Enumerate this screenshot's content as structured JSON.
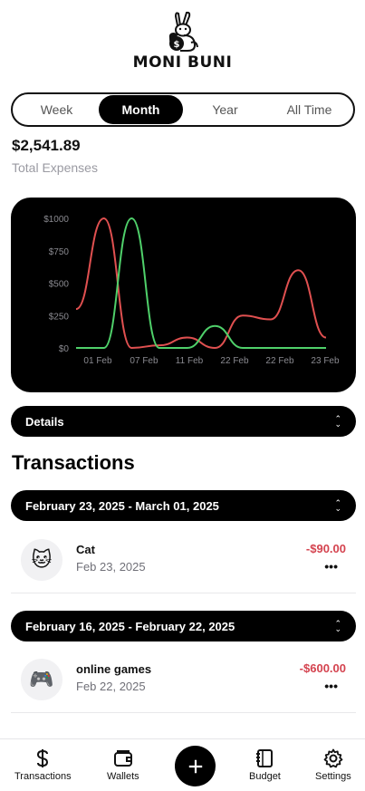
{
  "app": {
    "logo_text": "MONI BUNI"
  },
  "period": {
    "tabs": [
      {
        "label": "Week",
        "active": false
      },
      {
        "label": "Month",
        "active": true
      },
      {
        "label": "Year",
        "active": false
      },
      {
        "label": "All Time",
        "active": false
      }
    ]
  },
  "summary": {
    "total": "$2,541.89",
    "label": "Total Expenses"
  },
  "chart_data": {
    "type": "line",
    "x": [
      "01 Feb",
      "07 Feb",
      "11 Feb",
      "22 Feb",
      "22 Feb",
      "23 Feb"
    ],
    "yticks": [
      "$1000",
      "$750",
      "$500",
      "$250",
      "$0"
    ],
    "ylim": [
      0,
      1000
    ],
    "grid": false,
    "series": [
      {
        "color": "#e05050",
        "points": [
          [
            0,
            300
          ],
          [
            1,
            1000
          ],
          [
            2,
            0
          ],
          [
            3,
            20
          ],
          [
            4,
            80
          ],
          [
            5,
            0
          ],
          [
            6,
            250
          ],
          [
            7,
            220
          ],
          [
            8,
            600
          ],
          [
            9,
            80
          ]
        ]
      },
      {
        "color": "#4fd06a",
        "points": [
          [
            0,
            0
          ],
          [
            1,
            0
          ],
          [
            2,
            1000
          ],
          [
            3,
            0
          ],
          [
            4,
            0
          ],
          [
            5,
            170
          ],
          [
            6,
            0
          ],
          [
            7,
            0
          ],
          [
            8,
            0
          ],
          [
            9,
            0
          ]
        ]
      }
    ]
  },
  "details": {
    "label": "Details"
  },
  "transactions": {
    "title": "Transactions",
    "groups": [
      {
        "range": "February 23, 2025 - March 01, 2025",
        "items": [
          {
            "icon": "cat-icon",
            "emoji": "🐱",
            "name": "Cat",
            "date": "Feb 23, 2025",
            "amount": "-$90.00"
          }
        ]
      },
      {
        "range": "February 16, 2025 - February 22, 2025",
        "items": [
          {
            "icon": "gamepad-icon",
            "emoji": "🎮",
            "name": "online games",
            "date": "Feb 22, 2025",
            "amount": "-$600.00"
          }
        ]
      }
    ]
  },
  "nav": {
    "transactions": "Transactions",
    "wallets": "Wallets",
    "budget": "Budget",
    "settings": "Settings"
  },
  "colors": {
    "expense": "#d4434f",
    "accent": "#000000"
  }
}
